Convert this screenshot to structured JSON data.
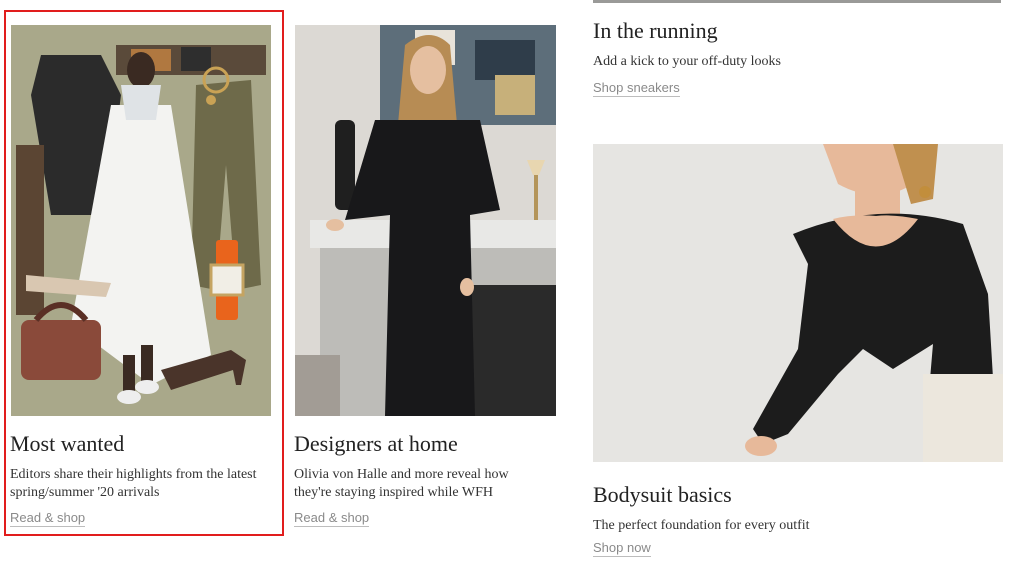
{
  "cards": [
    {
      "title": "Most wanted",
      "desc": "Editors share their highlights from the latest spring/summer '20 arrivals",
      "link": "Read & shop"
    },
    {
      "title": "Designers at home",
      "desc": "Olivia von Halle and more reveal how they're staying inspired while WFH",
      "link": "Read & shop"
    },
    {
      "title": "In the running",
      "desc": "Add a kick to your off-duty looks",
      "link": "Shop sneakers"
    },
    {
      "title": "Bodysuit basics",
      "desc": "The perfect foundation for every outfit",
      "link": "Shop now"
    }
  ],
  "colors": {
    "highlight": "#e11d1d",
    "link": "#8a8a8a"
  }
}
